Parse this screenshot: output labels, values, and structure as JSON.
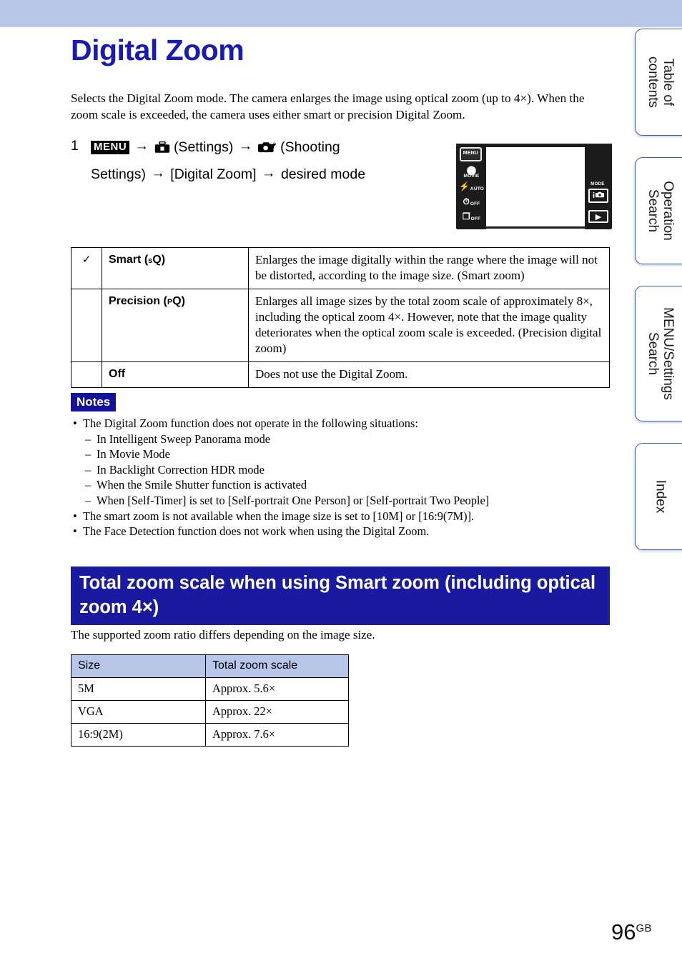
{
  "document": {
    "title": "Digital Zoom",
    "page_number": "96",
    "page_locale": "GB"
  },
  "intro": "Selects the Digital Zoom mode. The camera enlarges the image using optical zoom (up to 4×). When the zoom scale is exceeded, the camera uses either smart or precision Digital Zoom.",
  "step": {
    "number": "1",
    "menu_chip": "MENU",
    "arrow": "→",
    "settings_label": "(Settings)",
    "shooting_label_line1": "(Shooting",
    "shooting_label_line2": "Settings)",
    "item_label": "[Digital Zoom]",
    "tail_label": "desired mode",
    "settings_icon": "toolbox-icon",
    "shooting_icon": "camera-wrench-icon"
  },
  "camera_screen": {
    "menu_button": "MENU",
    "left_icons": [
      {
        "glyph": "⬤",
        "label": "MOVIE",
        "name": "movie-mode-icon"
      },
      {
        "glyph": "⚡",
        "label": "AUTO",
        "name": "flash-auto-icon"
      },
      {
        "glyph": "⏱",
        "label": "OFF",
        "name": "self-timer-off-icon"
      },
      {
        "glyph": "❐",
        "label": "OFF",
        "name": "burst-off-icon"
      }
    ],
    "mode_label": "MODE",
    "mode_button_text": "i",
    "mode_button_icon": "camera-icon",
    "playback_icon": "▶"
  },
  "options_table": {
    "rows": [
      {
        "checked": true,
        "check_mark": "✓",
        "name": "Smart",
        "name_suffix_pre": "s",
        "name_suffix_glyph": "Q",
        "description": "Enlarges the image digitally within the range where the image will not be distorted, according to the image size. (Smart zoom)"
      },
      {
        "checked": false,
        "check_mark": "",
        "name": "Precision",
        "name_suffix_pre": "P",
        "name_suffix_glyph": "Q",
        "description": "Enlarges all image sizes by the total zoom scale of approximately 8×, including the optical zoom 4×. However, note that the image quality deteriorates when the optical zoom scale is exceeded. (Precision digital zoom)"
      },
      {
        "checked": false,
        "check_mark": "",
        "name": "Off",
        "name_suffix_pre": "",
        "name_suffix_glyph": "",
        "description": "Does not use the Digital Zoom."
      }
    ]
  },
  "notes": {
    "badge": "Notes",
    "items": [
      {
        "level": 1,
        "text": "The Digital Zoom function does not operate in the following situations:"
      },
      {
        "level": 2,
        "text": "In Intelligent Sweep Panorama mode"
      },
      {
        "level": 2,
        "text": "In Movie Mode"
      },
      {
        "level": 2,
        "text": "In Backlight Correction HDR mode"
      },
      {
        "level": 2,
        "text": "When the Smile Shutter function is activated"
      },
      {
        "level": 2,
        "text": "When [Self-Timer] is set to [Self-portrait One Person] or [Self-portrait Two People]"
      },
      {
        "level": 1,
        "text": "The smart zoom is not available when the image size is set to [10M] or [16:9(7M)]."
      },
      {
        "level": 1,
        "text": "The Face Detection function does not work when using the Digital Zoom."
      }
    ]
  },
  "section": {
    "heading": "Total zoom scale when using Smart zoom (including optical zoom 4×)",
    "intro": "The supported zoom ratio differs depending on the image size."
  },
  "zoom_table": {
    "headers": [
      "Size",
      "Total zoom scale"
    ],
    "rows": [
      [
        "5M",
        "Approx. 5.6×"
      ],
      [
        "VGA",
        "Approx. 22×"
      ],
      [
        "16:9(2M)",
        "Approx. 7.6×"
      ]
    ]
  },
  "tabs": [
    {
      "label": "Table of\ncontents"
    },
    {
      "label": "Operation\nSearch"
    },
    {
      "label": "MENU/Settings\nSearch"
    },
    {
      "label": "Index"
    }
  ],
  "colors": {
    "banner": "#b8c6ea",
    "title": "#1a1ab4",
    "section_heading_bg": "#1a1aa0",
    "notes_badge_bg": "#12129c",
    "table_header_bg": "#b8c6ea",
    "tab_border": "#3b5ea8"
  }
}
